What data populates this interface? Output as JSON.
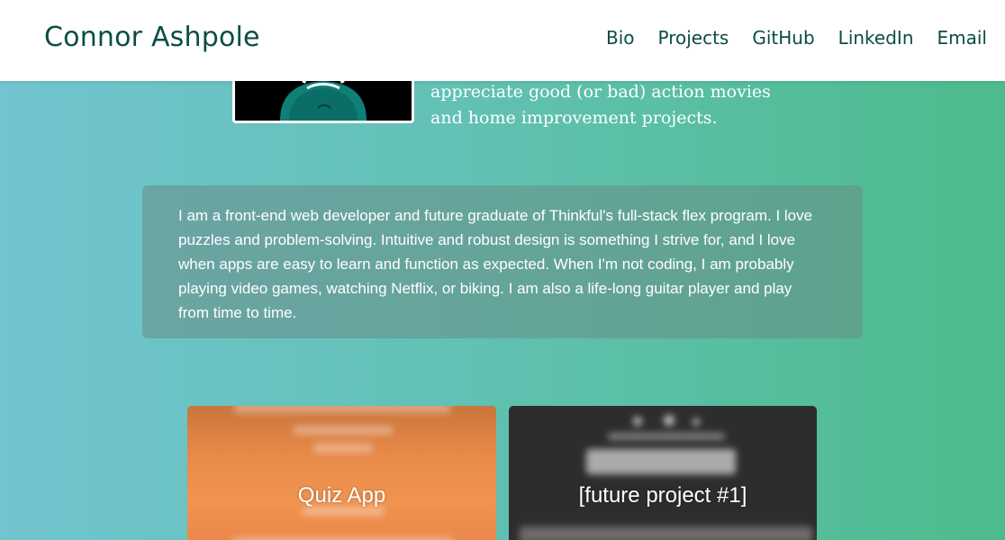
{
  "header": {
    "brand": "Connor Ashpole",
    "nav": [
      {
        "label": "Bio"
      },
      {
        "label": "Projects"
      },
      {
        "label": "GitHub"
      },
      {
        "label": "LinkedIn"
      },
      {
        "label": "Email"
      }
    ]
  },
  "intro": {
    "line1": "appreciate good (or bad) action movies",
    "line2": "and home improvement projects."
  },
  "bio": {
    "text": "I am a front-end web developer and future graduate of Thinkful's full-stack flex program. I love puzzles and problem-solving. Intuitive and robust design is something I strive for, and I love when apps are easy to learn and function as expected. When I'm not coding, I am probably playing video games, watching Netflix, or biking. I am also a life-long guitar player and play from time to time."
  },
  "projects": [
    {
      "title": "Quiz App"
    },
    {
      "title": "[future project #1]"
    }
  ],
  "colors": {
    "brand_text": "#0b4d46",
    "gradient_start": "#72c4d0",
    "gradient_end": "#4dbb8c",
    "bio_card": "#698c87",
    "quiz_card": "#f29450",
    "future_card": "#2d2d2d"
  }
}
